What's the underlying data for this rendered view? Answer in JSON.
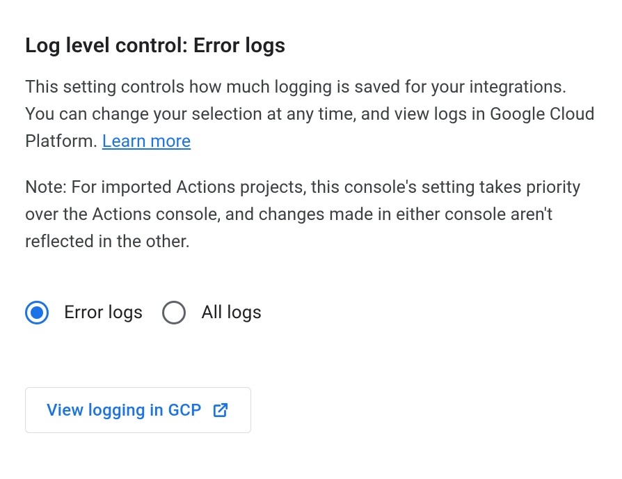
{
  "heading": "Log level control: Error logs",
  "description_part1": "This setting controls how much logging is saved for your integrations. You can change your selection at any time, and view logs in Google Cloud Platform. ",
  "learn_more": "Learn more",
  "note": "Note: For imported Actions projects, this console's setting takes priority over the Actions console, and changes made in either console aren't reflected in the other.",
  "radio": {
    "error_logs": "Error logs",
    "all_logs": "All logs",
    "selected": "error_logs"
  },
  "button": {
    "view_logging": "View logging in GCP"
  },
  "colors": {
    "primary": "#1a73e8",
    "text": "#202124",
    "text_secondary": "#3c4043",
    "border": "#dadce0"
  }
}
